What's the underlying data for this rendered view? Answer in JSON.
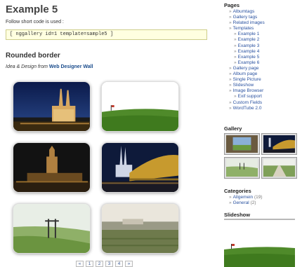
{
  "page_title": "Example 5",
  "intro_text": "Follow short code is used :",
  "shortcode": "[ nggallery id=1 template=sample5 ]",
  "subtitle": "Rounded border",
  "credit_prefix": "Idea & Design from",
  "credit_link": "Web Designer Wall",
  "thumbnails": [
    {
      "subject": "cathedral-night"
    },
    {
      "subject": "green-field-flag"
    },
    {
      "subject": "cathedral-dusk"
    },
    {
      "subject": "bridge-cathedral-night"
    },
    {
      "subject": "meadow-pylon"
    },
    {
      "subject": "field-village"
    }
  ],
  "pager": [
    "«",
    "1",
    "2",
    "3",
    "4",
    "»"
  ],
  "sidebar": {
    "pages_heading": "Pages",
    "pages": [
      {
        "label": "Albumtags",
        "level": 1
      },
      {
        "label": "Gallery tags",
        "level": 1
      },
      {
        "label": "Related images",
        "level": 1
      },
      {
        "label": "Templates",
        "level": 1
      },
      {
        "label": "Example 1",
        "level": 2
      },
      {
        "label": "Example 2",
        "level": 2
      },
      {
        "label": "Example 3",
        "level": 2
      },
      {
        "label": "Example 4",
        "level": 2
      },
      {
        "label": "Example 5",
        "level": 2
      },
      {
        "label": "Example 6",
        "level": 2
      },
      {
        "label": "Gallery page",
        "level": 1
      },
      {
        "label": "Album page",
        "level": 1
      },
      {
        "label": "Single Picture",
        "level": 1
      },
      {
        "label": "Slideshow",
        "level": 1
      },
      {
        "label": "Image Browser",
        "level": 1
      },
      {
        "label": "Exif support",
        "level": 2
      },
      {
        "label": "Custom Fields",
        "level": 1
      },
      {
        "label": "WordTube 2.0",
        "level": 1
      }
    ],
    "gallery_heading": "Gallery",
    "categories_heading": "Categories",
    "categories": [
      {
        "label": "Allgemein",
        "count": "(19)"
      },
      {
        "label": "General",
        "count": "(2)"
      }
    ],
    "slideshow_heading": "Slideshow"
  },
  "colors": {
    "link": "#2a52a0",
    "shortcode_bg": "#ffffe0",
    "shortcode_border": "#cdcd8a"
  }
}
